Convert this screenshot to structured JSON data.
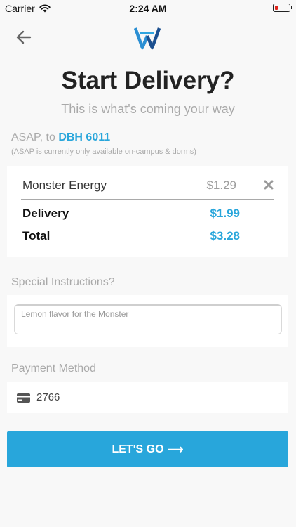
{
  "status_bar": {
    "carrier": "Carrier",
    "time": "2:24 AM",
    "battery_fraction": 0.1,
    "battery_color": "#e0251b"
  },
  "header": {
    "back_icon": "back-arrow-icon",
    "logo_icon": "wv-logo-icon"
  },
  "title": "Start Delivery?",
  "subtitle": "This is what's coming your way",
  "delivery_target": {
    "prefix": "ASAP, to",
    "location": "DBH 6011",
    "note": "(ASAP is currently only available on-campus & dorms)"
  },
  "order": {
    "items": [
      {
        "name": "Monster Energy",
        "price": "$1.29",
        "remove_icon": "close-x-icon"
      }
    ],
    "delivery_label": "Delivery",
    "delivery_value": "$1.99",
    "total_label": "Total",
    "total_value": "$3.28"
  },
  "instructions": {
    "label": "Special Instructions?",
    "value": "Lemon flavor for the Monster"
  },
  "payment": {
    "label": "Payment Method",
    "card_icon": "credit-card-icon",
    "card_last4": "2766"
  },
  "cta": {
    "label": "LET'S GO",
    "arrow": "⟶"
  },
  "colors": {
    "accent": "#28a6db",
    "muted": "#a9a9a9",
    "background": "#f8f8f8"
  }
}
